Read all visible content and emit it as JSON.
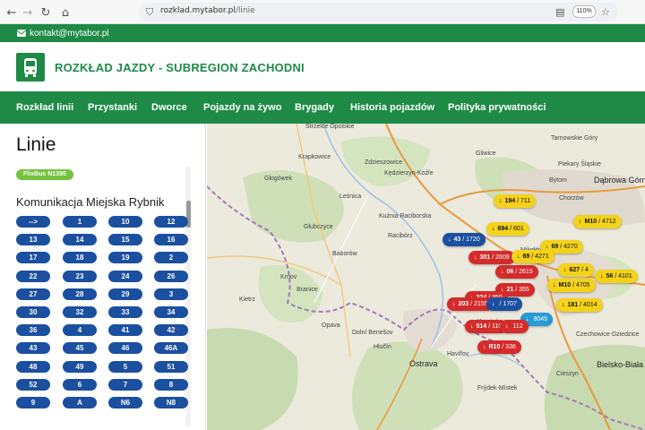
{
  "browser": {
    "url_host": "rozklad.mytabor.pl",
    "url_path": "/linie",
    "zoom": "110%"
  },
  "site": {
    "contact": "kontakt@mytabor.pl",
    "title": "ROZKŁAD JAZDY - SUBREGION ZACHODNI",
    "menu": [
      "Rozkład linii",
      "Przystanki",
      "Dworce",
      "Pojazdy na żywo",
      "Brygady",
      "Historia pojazdów",
      "Polityka prywatności"
    ]
  },
  "sidebar": {
    "title": "Linie",
    "flix_badge": "FlixBus N1395",
    "section": "Komunikacja Miejska Rybnik",
    "lines": [
      "-->",
      "1",
      "10",
      "12",
      "13",
      "14",
      "15",
      "16",
      "17",
      "18",
      "19",
      "2",
      "22",
      "23",
      "24",
      "26",
      "27",
      "28",
      "29",
      "3",
      "30",
      "32",
      "33",
      "34",
      "36",
      "4",
      "41",
      "42",
      "43",
      "45",
      "46",
      "46A",
      "48",
      "49",
      "5",
      "51",
      "52",
      "6",
      "7",
      "8",
      "9",
      "A",
      "N6",
      "N8"
    ]
  },
  "map": {
    "cities": [
      {
        "name": "Tarnowskie Góry",
        "big": false
      },
      {
        "name": "Piekary Śląskie",
        "big": false
      },
      {
        "name": "Dąbrowa Górnicza",
        "big": true
      },
      {
        "name": "Bytom",
        "big": false
      },
      {
        "name": "Chorzów",
        "big": false
      },
      {
        "name": "Kędzierzyn-Koźle",
        "big": false
      },
      {
        "name": "Kuźnia Raciborska",
        "big": false
      },
      {
        "name": "Racibórz",
        "big": false
      },
      {
        "name": "Krapkowice",
        "big": false
      },
      {
        "name": "Strzelce Opolskie",
        "big": false
      },
      {
        "name": "Głogówek",
        "big": false
      },
      {
        "name": "Głubczyce",
        "big": false
      },
      {
        "name": "Baborów",
        "big": false
      },
      {
        "name": "Krnov",
        "big": false
      },
      {
        "name": "Opava",
        "big": false
      },
      {
        "name": "Ostrava",
        "big": true
      },
      {
        "name": "Bielsko-Biała",
        "big": true
      },
      {
        "name": "Havířov",
        "big": false
      },
      {
        "name": "Karviná",
        "big": false
      },
      {
        "name": "Frýdek-Místek",
        "big": false
      },
      {
        "name": "Cieszyn",
        "big": false
      },
      {
        "name": "Mikołów",
        "big": false
      },
      {
        "name": "Tychy",
        "big": false
      },
      {
        "name": "Kietrz",
        "big": false
      },
      {
        "name": "Branice",
        "big": false
      },
      {
        "name": "Dolní Benešov",
        "big": false
      },
      {
        "name": "Hlučín",
        "big": false
      },
      {
        "name": "Zdzieszowice",
        "big": false
      },
      {
        "name": "Leśnica",
        "big": false
      },
      {
        "name": "Gliwice",
        "big": false
      },
      {
        "name": "Czechowice-Dziedzice",
        "big": false
      }
    ],
    "pins": [
      {
        "label": "194",
        "sub": "/ 711",
        "color": "#f4d21a",
        "text": "#111"
      },
      {
        "label": "694",
        "sub": "/ 601",
        "color": "#f4d21a",
        "text": "#111"
      },
      {
        "label": "M10",
        "sub": "/ 4712",
        "color": "#f4d21a",
        "text": "#111"
      },
      {
        "label": "69",
        "sub": "/ 4270",
        "color": "#f4d21a",
        "text": "#111"
      },
      {
        "label": "43",
        "sub": "/ 1720",
        "color": "#1b4fa0",
        "text": "#fff"
      },
      {
        "label": "627",
        "sub": "/ 4",
        "color": "#f4d21a",
        "text": "#111"
      },
      {
        "label": "56",
        "sub": "/ 4101",
        "color": "#f4d21a",
        "text": "#111"
      },
      {
        "label": "M10",
        "sub": "/ 4705",
        "color": "#f4d21a",
        "text": "#111"
      },
      {
        "label": "181",
        "sub": "/ 4014",
        "color": "#f4d21a",
        "text": "#111"
      },
      {
        "label": "301",
        "sub": "/ 2609",
        "color": "#d42b2b",
        "text": "#fff"
      },
      {
        "label": "06",
        "sub": "/ 2615",
        "color": "#d42b2b",
        "text": "#fff"
      },
      {
        "label": "69",
        "sub": "/ 4271",
        "color": "#f4d21a",
        "text": "#111"
      },
      {
        "label": "21",
        "sub": "/ 355",
        "color": "#d42b2b",
        "text": "#fff"
      },
      {
        "label": "324",
        "sub": "/ 350",
        "color": "#d42b2b",
        "text": "#fff"
      },
      {
        "label": "203",
        "sub": "/ 2155",
        "color": "#d42b2b",
        "text": "#fff"
      },
      {
        "label": "",
        "sub": "/ 1707",
        "color": "#1b4fa0",
        "text": "#fff"
      },
      {
        "label": "",
        "sub": "8045",
        "color": "#2a9ad6",
        "text": "#fff"
      },
      {
        "label": "514",
        "sub": "/ 110",
        "color": "#d42b2b",
        "text": "#fff"
      },
      {
        "label": "",
        "sub": "112",
        "color": "#d42b2b",
        "text": "#fff"
      },
      {
        "label": "R10",
        "sub": "/ 336",
        "color": "#d42b2b",
        "text": "#fff"
      }
    ]
  }
}
